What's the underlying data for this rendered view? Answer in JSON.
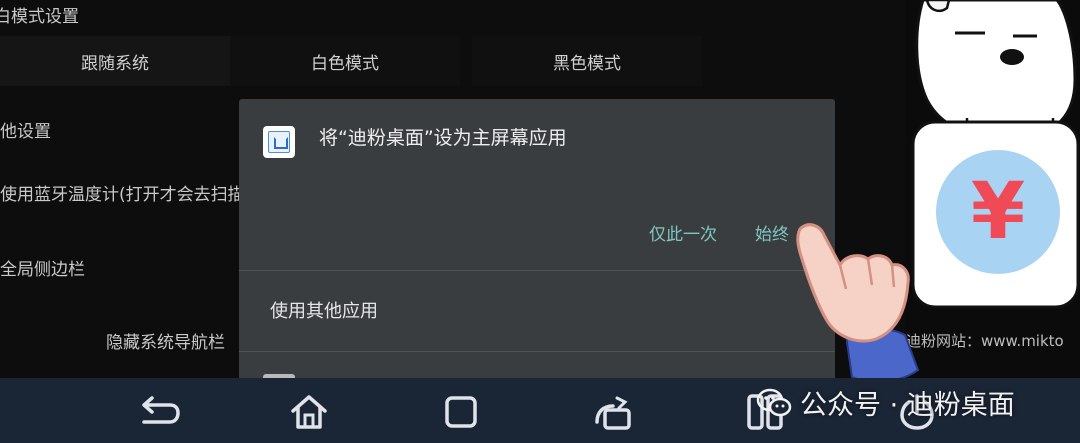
{
  "settings": {
    "theme_section_title": "白模式设置",
    "theme_options": [
      "跟随系统",
      "白色模式",
      "黑色模式"
    ],
    "other_section_title": "他设置",
    "bluetooth_item": "使用蓝牙温度计(打开才会去扫描",
    "sidebar_item": "全局侧边栏",
    "hide_nav_item": "隐藏系统导航栏"
  },
  "dialog": {
    "app_icon": "launcher-app-icon",
    "title": "将“迪粉桌面”设为主屏幕应用",
    "just_once_label": "仅此一次",
    "always_label": "始终",
    "other_app_label": "使用其他应用"
  },
  "overlay": {
    "website": "迪粉网站：www.mikto",
    "watermark": "公众号 · 迪粉桌面",
    "watermark_icon": "wechat-icon",
    "coin_symbol": "¥"
  },
  "nav": {
    "back_icon": "back-icon",
    "home_icon": "home-icon",
    "recents_icon": "recents-icon",
    "screenshot_icon": "screenshot-icon",
    "split_icon": "split-screen-icon",
    "power_icon": "power-icon"
  },
  "colors": {
    "accent": "#7fc8bf",
    "dialog_bg": "#3a3d40",
    "navbar_bg": "#1a2535",
    "coin_bg": "#a9d3f2",
    "coin_symbol": "#ef4a55"
  }
}
